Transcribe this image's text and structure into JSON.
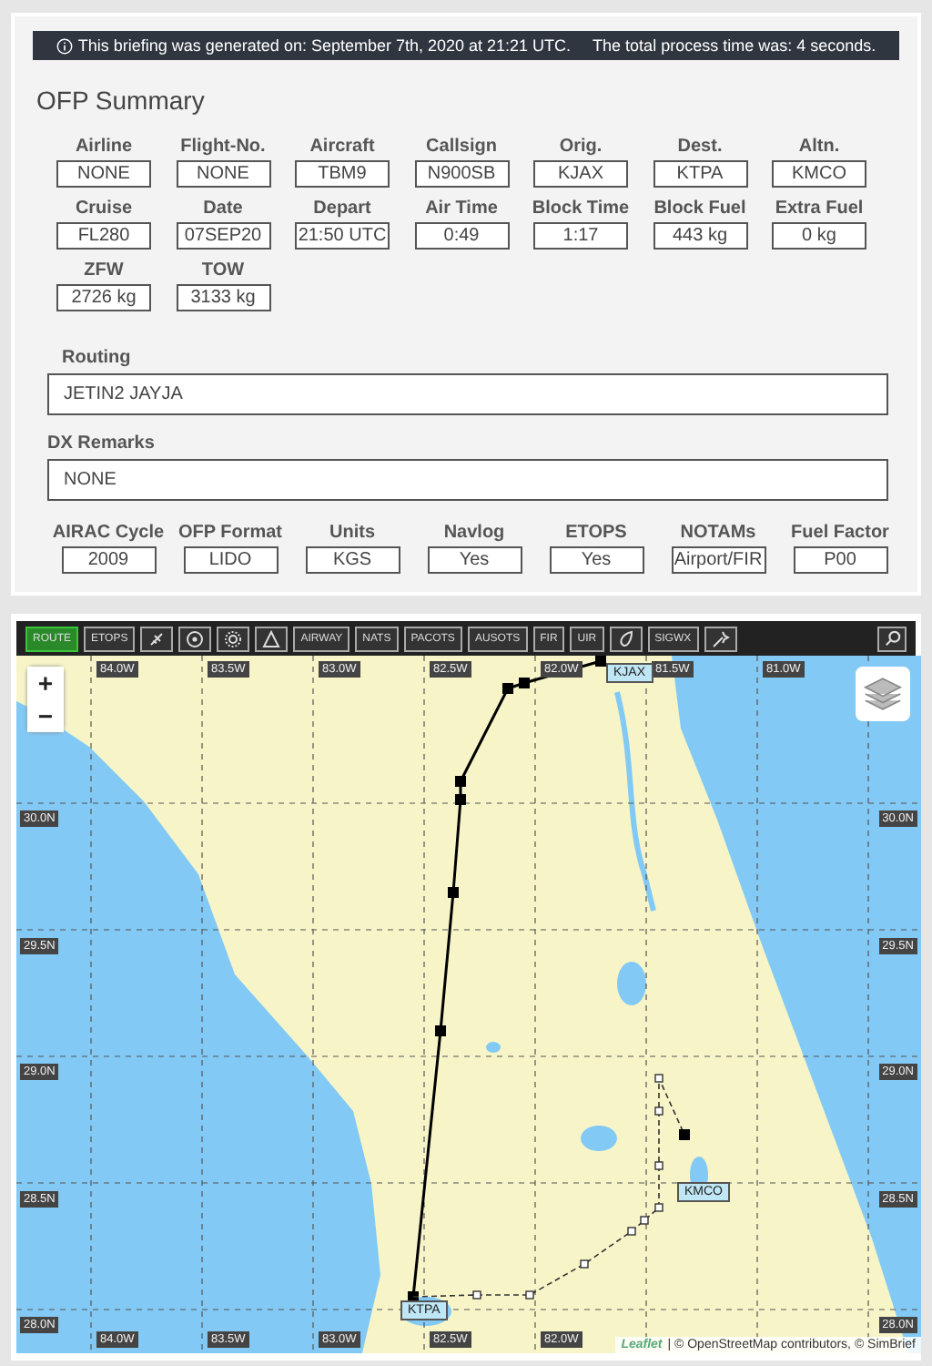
{
  "banner": {
    "generated": "This briefing was generated on: September 7th, 2020 at 21:21 UTC.",
    "process": "The total process time was: 4 seconds."
  },
  "summary": {
    "title": "OFP Summary",
    "rows": [
      [
        {
          "label": "Airline",
          "value": "NONE"
        },
        {
          "label": "Flight-No.",
          "value": "NONE"
        },
        {
          "label": "Aircraft",
          "value": "TBM9"
        },
        {
          "label": "Callsign",
          "value": "N900SB"
        },
        {
          "label": "Orig.",
          "value": "KJAX"
        },
        {
          "label": "Dest.",
          "value": "KTPA"
        },
        {
          "label": "Altn.",
          "value": "KMCO"
        }
      ],
      [
        {
          "label": "Cruise",
          "value": "FL280"
        },
        {
          "label": "Date",
          "value": "07SEP20"
        },
        {
          "label": "Depart",
          "value": "21:50 UTC"
        },
        {
          "label": "Air Time",
          "value": "0:49"
        },
        {
          "label": "Block Time",
          "value": "1:17"
        },
        {
          "label": "Block Fuel",
          "value": "443 kg"
        },
        {
          "label": "Extra Fuel",
          "value": "0 kg"
        }
      ],
      [
        {
          "label": "ZFW",
          "value": "2726 kg"
        },
        {
          "label": "TOW",
          "value": "3133 kg"
        }
      ]
    ],
    "routing": {
      "label": "Routing",
      "value": "JETIN2 JAYJA"
    },
    "remarks": {
      "label": "DX Remarks",
      "value": "NONE"
    },
    "settings": [
      {
        "label": "AIRAC Cycle",
        "value": "2009"
      },
      {
        "label": "OFP Format",
        "value": "LIDO"
      },
      {
        "label": "Units",
        "value": "KGS"
      },
      {
        "label": "Navlog",
        "value": "Yes"
      },
      {
        "label": "ETOPS",
        "value": "Yes"
      },
      {
        "label": "NOTAMs",
        "value": "Airport/FIR"
      },
      {
        "label": "Fuel Factor",
        "value": "P00"
      }
    ]
  },
  "map": {
    "toolbar": [
      {
        "kind": "text",
        "label": "ROUTE",
        "selected": true
      },
      {
        "kind": "text",
        "label": "ETOPS",
        "selected": false
      },
      {
        "kind": "icon",
        "selected": false
      },
      {
        "kind": "icon",
        "selected": false
      },
      {
        "kind": "icon",
        "selected": false
      },
      {
        "kind": "icon",
        "selected": false
      },
      {
        "kind": "text",
        "label": "AIRWAY",
        "selected": false
      },
      {
        "kind": "text",
        "label": "NATS",
        "selected": false
      },
      {
        "kind": "text",
        "label": "PACOTS",
        "selected": false
      },
      {
        "kind": "text",
        "label": "AUSOTS",
        "selected": false
      },
      {
        "kind": "text",
        "label": "FIR",
        "selected": false
      },
      {
        "kind": "text",
        "label": "UIR",
        "selected": false
      },
      {
        "kind": "icon",
        "selected": false
      },
      {
        "kind": "text",
        "label": "SIGWX",
        "selected": false
      },
      {
        "kind": "icon",
        "selected": false
      }
    ],
    "zoom_in": "+",
    "zoom_out": "−",
    "top_labels": [
      "84.0W",
      "83.5W",
      "83.0W",
      "82.5W",
      "82.0W",
      "81.5W",
      "81.0W"
    ],
    "bottom_labels": [
      "84.0W",
      "83.5W",
      "83.0W",
      "82.5W",
      "82.0W"
    ],
    "left_lat_labels": [
      "30.0N",
      "29.5N",
      "29.0N",
      "28.5N",
      "28.0N"
    ],
    "right_lat_labels": [
      "30.0N",
      "29.5N",
      "29.0N",
      "28.5N",
      "28.0N"
    ],
    "airports": [
      {
        "code": "KJAX",
        "kind": "origin"
      },
      {
        "code": "KTPA",
        "kind": "destination"
      },
      {
        "code": "KMCO",
        "kind": "alternate"
      }
    ],
    "attribution": {
      "brand": "Leaflet",
      "text": "| © OpenStreetMap contributors, © SimBrief"
    }
  }
}
